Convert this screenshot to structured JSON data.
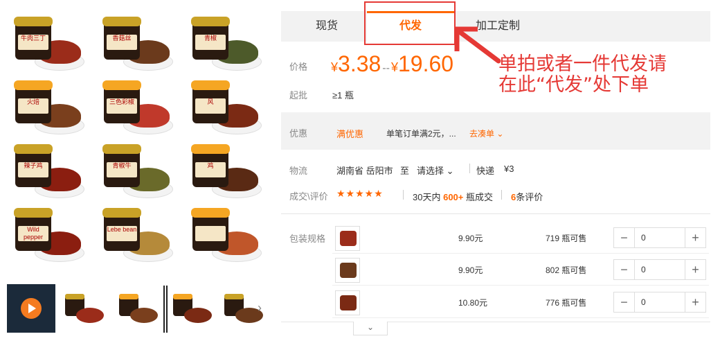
{
  "gallery": {
    "products": [
      {
        "label": "牛肉三丁",
        "lid": "#c9a227",
        "food": "#9b2c1a"
      },
      {
        "label": "香菇丝",
        "lid": "#c9a227",
        "food": "#6b3a1c"
      },
      {
        "label": "青椒",
        "lid": "#c9a227",
        "food": "#4d5a2a"
      },
      {
        "label": "火焙",
        "lid": "#f5a623",
        "food": "#7a3f1d"
      },
      {
        "label": "三色彩椒",
        "lid": "#f5a623",
        "food": "#c0392b"
      },
      {
        "label": "风",
        "lid": "#f5a623",
        "food": "#7b2a14"
      },
      {
        "label": "辣子鸡",
        "lid": "#c9a227",
        "food": "#8b1e10"
      },
      {
        "label": "青椒牛",
        "lid": "#c9a227",
        "food": "#6a6a2a"
      },
      {
        "label": "鸡",
        "lid": "#f5a623",
        "food": "#5a2a14"
      },
      {
        "label": "Wild pepper",
        "lid": "#c9a227",
        "food": "#8b1e10"
      },
      {
        "label": "Lebe bean",
        "lid": "#c9a227",
        "food": "#b58a3a"
      },
      {
        "label": "",
        "lid": "#f5a623",
        "food": "#c0562a"
      }
    ]
  },
  "tabs": [
    {
      "label": "现货"
    },
    {
      "label": "代发"
    },
    {
      "label": "加工定制"
    }
  ],
  "price": {
    "label": "价格",
    "currency": "¥",
    "low": "3.38",
    "sep": "--",
    "high": "19.60"
  },
  "moq": {
    "label": "起批",
    "value": "≥1 瓶"
  },
  "annotation": {
    "line1": "单拍或者一件代发请",
    "line2": "在此“代发”处下单"
  },
  "promo": {
    "label": "优惠",
    "tag": "满优惠",
    "desc": "单笔订单满2元，...",
    "link": "去凑单 ⌄"
  },
  "shipping": {
    "label": "物流",
    "origin": "湖南省 岳阳市",
    "to": "至",
    "dest": "请选择 ⌄",
    "method": "快递",
    "fee": "¥3"
  },
  "deals": {
    "label": "成交\\评价",
    "stars": "★★★★★",
    "days_prefix": "30天内",
    "days_num": "600+",
    "days_suffix": "瓶成交",
    "reviews_num": "6",
    "reviews_suffix": "条评价"
  },
  "specs": {
    "label": "包装规格",
    "rows": [
      {
        "price": "9.90元",
        "stock": "719 瓶可售",
        "qty": "0",
        "color": "#9b2c1a"
      },
      {
        "price": "9.90元",
        "stock": "802 瓶可售",
        "qty": "0",
        "color": "#6b3a1c"
      },
      {
        "price": "10.80元",
        "stock": "776 瓶可售",
        "qty": "0",
        "color": "#7b2a14"
      }
    ],
    "minus": "−",
    "plus": "+"
  },
  "expand_icon": "⌄",
  "next_icon": "›",
  "colors": {
    "accent": "#ff6600",
    "annotation": "#e53935",
    "tab_bg": "#f2f2f2"
  }
}
